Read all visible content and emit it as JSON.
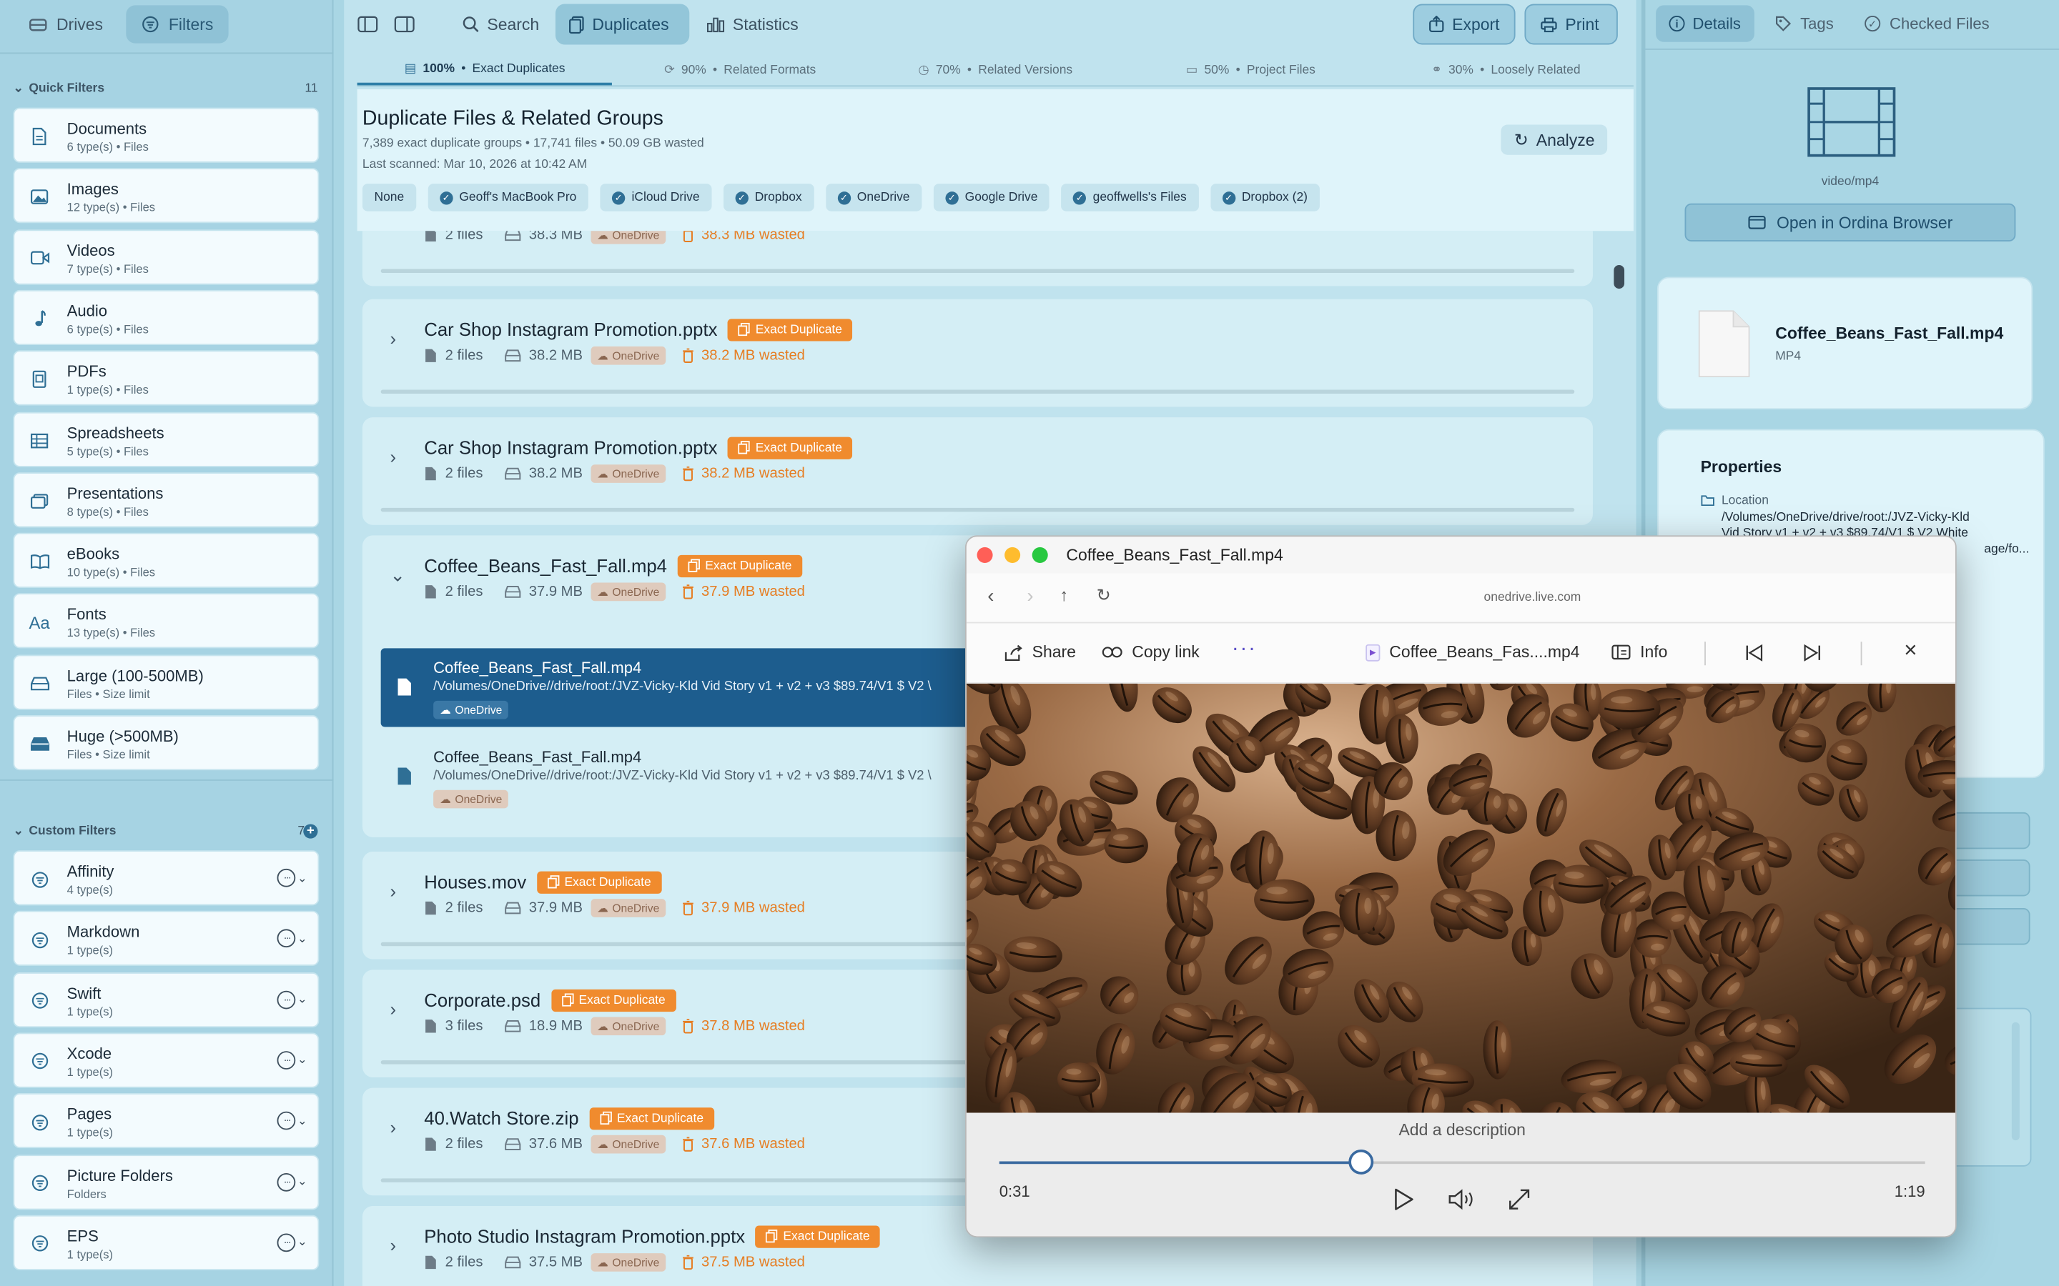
{
  "sidebar": {
    "tabs": [
      {
        "label": "Drives",
        "icon": "drive-icon"
      },
      {
        "label": "Filters",
        "icon": "filter-icon"
      }
    ],
    "quick_filters": {
      "title": "Quick Filters",
      "count": "11",
      "items": [
        {
          "label": "Documents",
          "sub": "6 type(s) • Files",
          "icon": "document-icon"
        },
        {
          "label": "Images",
          "sub": "12 type(s) • Files",
          "icon": "image-icon"
        },
        {
          "label": "Videos",
          "sub": "7 type(s) • Files",
          "icon": "video-icon"
        },
        {
          "label": "Audio",
          "sub": "6 type(s) • Files",
          "icon": "music-note-icon"
        },
        {
          "label": "PDFs",
          "sub": "1 type(s) • Files",
          "icon": "pdf-icon"
        },
        {
          "label": "Spreadsheets",
          "sub": "5 type(s) • Files",
          "icon": "table-icon"
        },
        {
          "label": "Presentations",
          "sub": "8 type(s) • Files",
          "icon": "presentation-icon"
        },
        {
          "label": "eBooks",
          "sub": "10 type(s) • Files",
          "icon": "book-icon"
        },
        {
          "label": "Fonts",
          "sub": "13 type(s) • Files",
          "icon": "font-icon"
        },
        {
          "label": "Large (100-500MB)",
          "sub": "Files • Size limit",
          "icon": "drive-icon"
        },
        {
          "label": "Huge (>500MB)",
          "sub": "Files • Size limit",
          "icon": "drive-full-icon"
        }
      ]
    },
    "custom_filters": {
      "title": "Custom Filters",
      "count": "7",
      "items": [
        {
          "label": "Affinity",
          "sub": "4 type(s)"
        },
        {
          "label": "Markdown",
          "sub": "1 type(s)"
        },
        {
          "label": "Swift",
          "sub": "1 type(s)"
        },
        {
          "label": "Xcode",
          "sub": "1 type(s)"
        },
        {
          "label": "Pages",
          "sub": "1 type(s)"
        },
        {
          "label": "Picture  Folders",
          "sub": "Folders"
        },
        {
          "label": "EPS",
          "sub": "1 type(s)"
        }
      ]
    }
  },
  "toolbar": {
    "search": "Search",
    "duplicates": "Duplicates",
    "statistics": "Statistics",
    "export": "Export",
    "print": "Print"
  },
  "relation_tabs": [
    {
      "pct": "100%",
      "label": "Exact Duplicates"
    },
    {
      "pct": "90%",
      "label": "Related Formats"
    },
    {
      "pct": "70%",
      "label": "Related Versions"
    },
    {
      "pct": "50%",
      "label": "Project Files"
    },
    {
      "pct": "30%",
      "label": "Loosely Related"
    }
  ],
  "header": {
    "title": "Duplicate Files & Related Groups",
    "summary": "7,389 exact duplicate groups • 17,741 files • 50.09 GB wasted",
    "scanned": "Last scanned: Mar 10, 2026 at 10:42 AM",
    "analyze": "Analyze",
    "drives": [
      "None",
      "Geoff's MacBook Pro",
      "iCloud Drive",
      "Dropbox",
      "OneDrive",
      "Google Drive",
      "geoffwells's Files",
      "Dropbox (2)"
    ]
  },
  "badge_label": "Exact Duplicate",
  "cloud_label": "OneDrive",
  "groups": [
    {
      "name": "",
      "files": "2 files",
      "size": "38.3 MB",
      "wasted": "38.3 MB wasted"
    },
    {
      "name": "Car Shop Instagram Promotion.pptx",
      "files": "2 files",
      "size": "38.2 MB",
      "wasted": "38.2 MB wasted"
    },
    {
      "name": "Car Shop Instagram Promotion.pptx",
      "files": "2 files",
      "size": "38.2 MB",
      "wasted": "38.2 MB wasted"
    },
    {
      "name": "Coffee_Beans_Fast_Fall.mp4",
      "files": "2 files",
      "size": "37.9 MB",
      "wasted": "37.9 MB wasted"
    },
    {
      "name": "Houses.mov",
      "files": "2 files",
      "size": "37.9 MB",
      "wasted": "37.9 MB wasted"
    },
    {
      "name": "Corporate.psd",
      "files": "3 files",
      "size": "18.9 MB",
      "wasted": "37.8 MB wasted"
    },
    {
      "name": "40.Watch Store.zip",
      "files": "2 files",
      "size": "37.6 MB",
      "wasted": "37.6 MB wasted"
    },
    {
      "name": "Photo Studio Instagram Promotion.pptx",
      "files": "2 files",
      "size": "37.5 MB",
      "wasted": "37.5 MB wasted"
    }
  ],
  "expanded_files": [
    {
      "name": "Coffee_Beans_Fast_Fall.mp4",
      "path": "/Volumes/OneDrive//drive/root:/JVZ-Vicky-Kld Vid Story v1 + v2 + v3 $89.74/V1 $ V2 \\"
    },
    {
      "name": "Coffee_Beans_Fast_Fall.mp4",
      "path": "/Volumes/OneDrive//drive/root:/JVZ-Vicky-Kld Vid Story v1 + v2 + v3 $89.74/V1 $ V2 \\"
    }
  ],
  "right": {
    "tabs": [
      "Details",
      "Tags",
      "Checked Files"
    ],
    "mime": "video/mp4",
    "open_button": "Open in Ordina Browser",
    "file_name": "Coffee_Beans_Fast_Fall.mp4",
    "file_type": "MP4",
    "properties_title": "Properties",
    "location_label": "Location",
    "location_lines": [
      "/Volumes/OneDrive/drive/root:/JVZ-Vicky-Kld",
      "Vid Story v1 + v2 + v3 $89.74/V1 $ V2 White",
      "age/fo..."
    ]
  },
  "viewer": {
    "title": "Coffee_Beans_Fast_Fall.mp4",
    "url": "onedrive.live.com",
    "share": "Share",
    "copy_link": "Copy link",
    "file_label": "Coffee_Beans_Fas....mp4",
    "info": "Info",
    "description_placeholder": "Add a description",
    "current_time": "0:31",
    "duration": "1:19",
    "progress_fraction": 0.39
  },
  "colors": {
    "accent": "#2f6f95",
    "orange": "#f08b2e",
    "selected": "#1d5d8e"
  }
}
